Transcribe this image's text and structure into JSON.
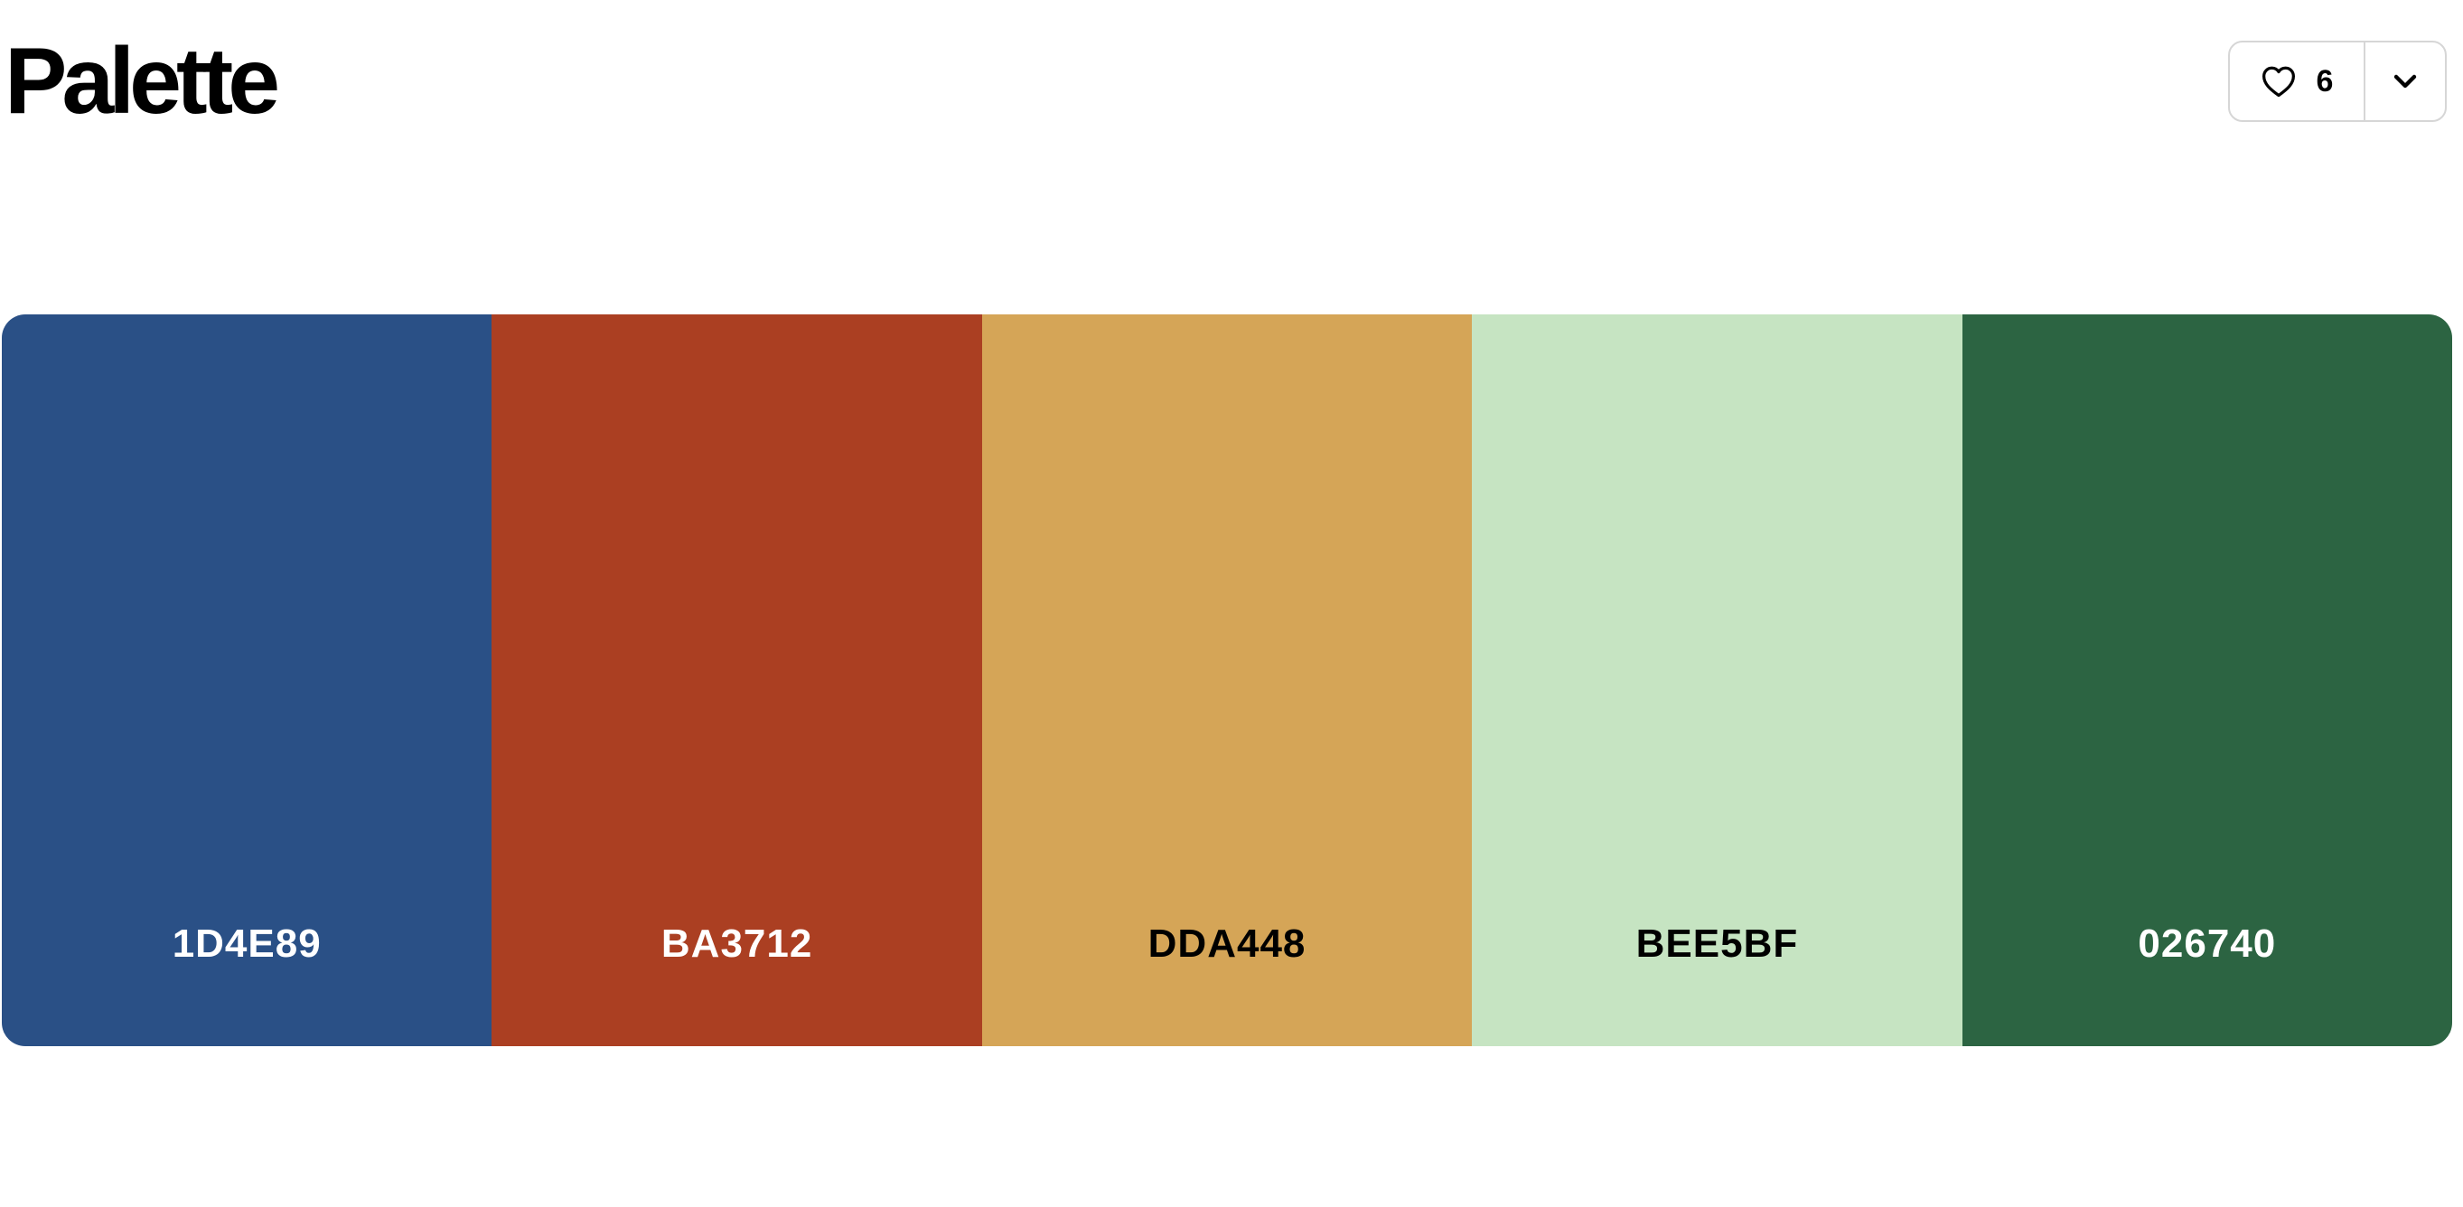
{
  "header": {
    "title": "Palette"
  },
  "actions": {
    "like_count": "6",
    "like_icon": "heart-outline-icon",
    "menu_icon": "chevron-down-icon"
  },
  "palette": {
    "swatches": [
      {
        "code": "1D4E89",
        "color": "#2A5086",
        "text_color": "#FFFFFF"
      },
      {
        "code": "BA3712",
        "color": "#AB3F22",
        "text_color": "#FFFFFF"
      },
      {
        "code": "DDA448",
        "color": "#D5A557",
        "text_color": "#000000"
      },
      {
        "code": "BEE5BF",
        "color": "#C6E4C2",
        "text_color": "#000000"
      },
      {
        "code": "026740",
        "color": "#2C6442",
        "text_color": "#FFFFFF"
      }
    ]
  }
}
